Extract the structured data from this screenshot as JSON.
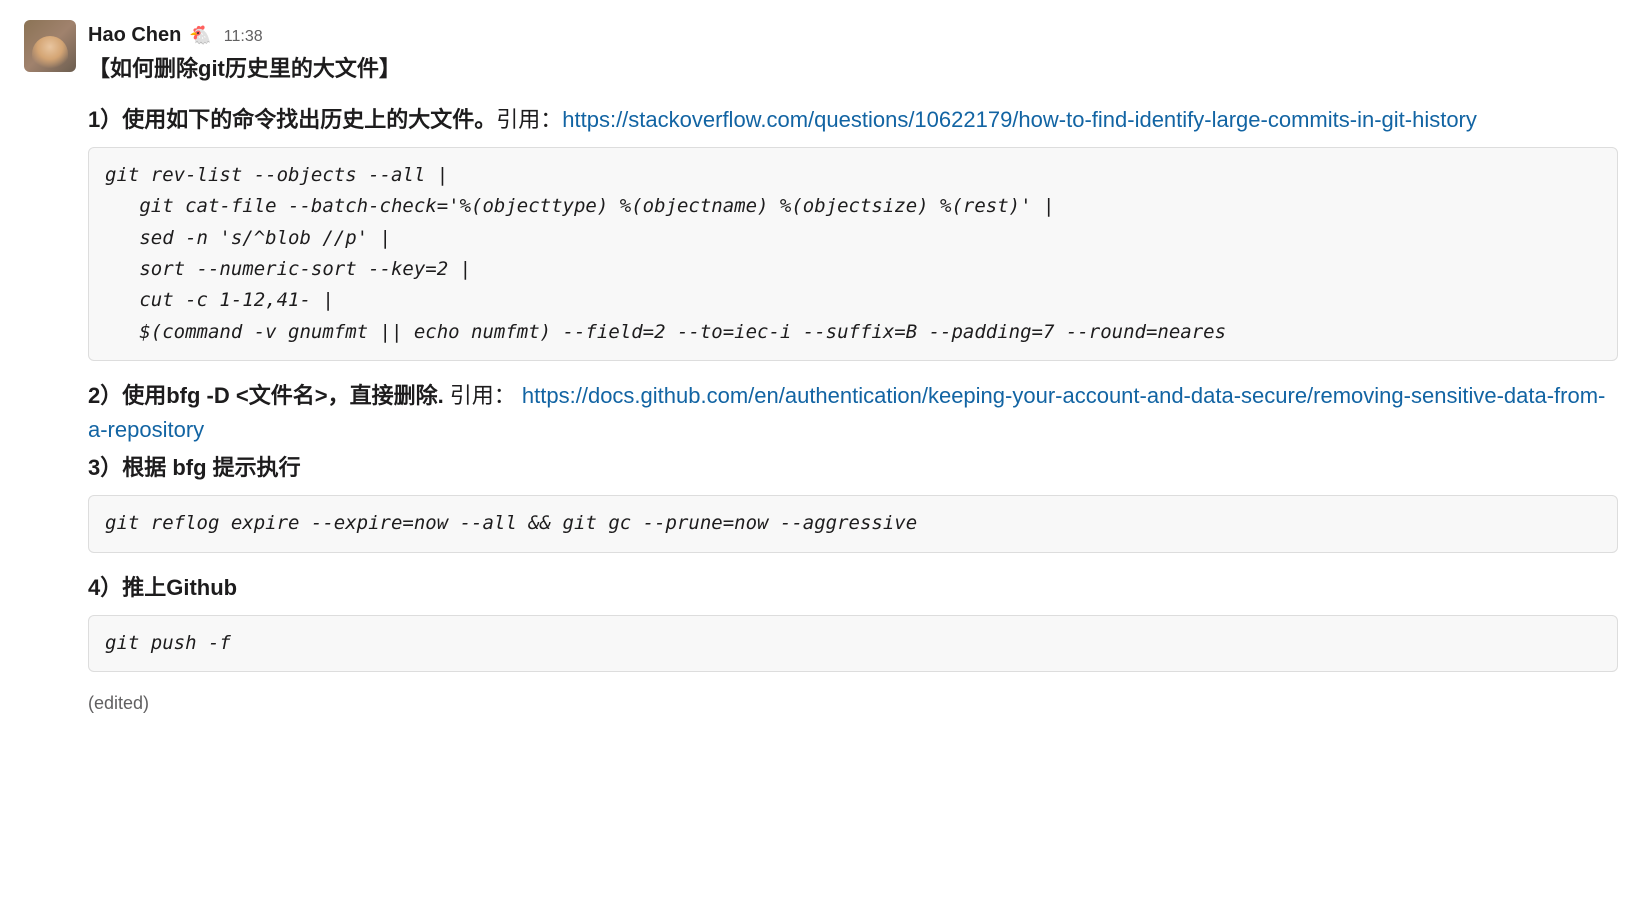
{
  "message": {
    "author": "Hao Chen",
    "status_emoji": "🐔",
    "time": "11:38",
    "title": "【如何删除git历史里的大文件】",
    "step1_bold": "1）使用如下的命令找出历史上的大文件。",
    "step1_plain": "引用：",
    "step1_link": "https://stackoverflow.com/questions/10622179/how-to-find-identify-large-commits-in-git-history",
    "code1": "git rev-list --objects --all |\n   git cat-file --batch-check='%(objecttype) %(objectname) %(objectsize) %(rest)' |\n   sed -n 's/^blob //p' |\n   sort --numeric-sort --key=2 |\n   cut -c 1-12,41- |\n   $(command -v gnumfmt || echo numfmt) --field=2 --to=iec-i --suffix=B --padding=7 --round=neares",
    "step2_bold": "2）使用bfg -D <文件名>，直接删除.",
    "step2_plain": " 引用： ",
    "step2_link": "https://docs.github.com/en/authentication/keeping-your-account-and-data-secure/removing-sensitive-data-from-a-repository",
    "step3_bold": "3）根据 bfg 提示执行",
    "code2": "git reflog expire --expire=now --all && git gc --prune=now --aggressive",
    "step4_bold": "4）推上Github",
    "code3": "git push -f",
    "edited_label": "(edited)"
  }
}
